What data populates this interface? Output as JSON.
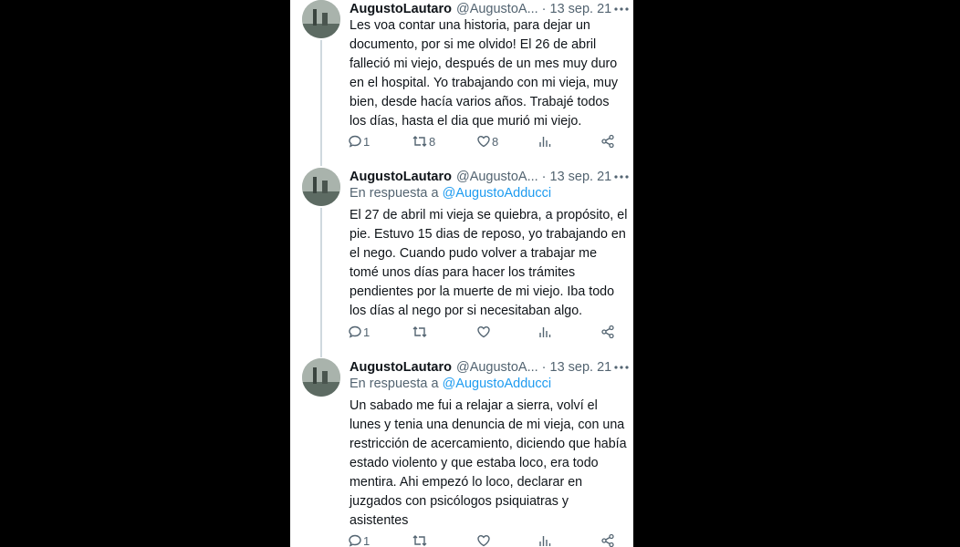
{
  "tweets": [
    {
      "name": "AugustoLautaro",
      "handle": "@AugustoA...",
      "dot": "·",
      "date": "13 sep. 21",
      "reply_prefix": "",
      "reply_mention": "",
      "text": "Les voa contar una historia, para dejar un documento, por si me olvido! El 26 de abril falleció mi viejo, después de un mes muy duro en el hospital. Yo trabajando con mi vieja, muy bien, desde hacía varios años. Trabajé todos los días, hasta el dia que murió mi viejo.",
      "replies": "1",
      "retweets": "8",
      "likes": "8"
    },
    {
      "name": "AugustoLautaro",
      "handle": "@AugustoA...",
      "dot": "·",
      "date": "13 sep. 21",
      "reply_prefix": "En respuesta a ",
      "reply_mention": "@AugustoAdducci",
      "text": "El 27 de abril mi vieja se quiebra, a propósito, el pie. Estuvo 15 dias de reposo, yo trabajando en el nego. Cuando pudo volver a trabajar me tomé unos días para hacer los trámites pendientes por la muerte de mi viejo. Iba todo los días al nego por si necesitaban algo.",
      "replies": "1",
      "retweets": "",
      "likes": ""
    },
    {
      "name": "AugustoLautaro",
      "handle": "@AugustoA...",
      "dot": "·",
      "date": "13 sep. 21",
      "reply_prefix": "En respuesta a ",
      "reply_mention": "@AugustoAdducci",
      "text": "Un sabado me fui a relajar a sierra, volví el lunes y tenia una denuncia de mi vieja, con una restricción de acercamiento, diciendo que había estado violento y que estaba loco, era todo mentira. Ahi empezó lo loco, declarar en juzgados con psicólogos psiquiatras y asistentes",
      "replies": "1",
      "retweets": "",
      "likes": ""
    }
  ],
  "icons": {
    "more": "more-dots-icon",
    "reply": "reply-bubble-icon",
    "retweet": "retweet-icon",
    "like": "heart-icon",
    "views": "views-bar-chart-icon",
    "share": "share-icon"
  },
  "colors": {
    "mention": "#1d9bf0",
    "secondary_text": "#536471",
    "thread_line": "#cfd9de"
  }
}
